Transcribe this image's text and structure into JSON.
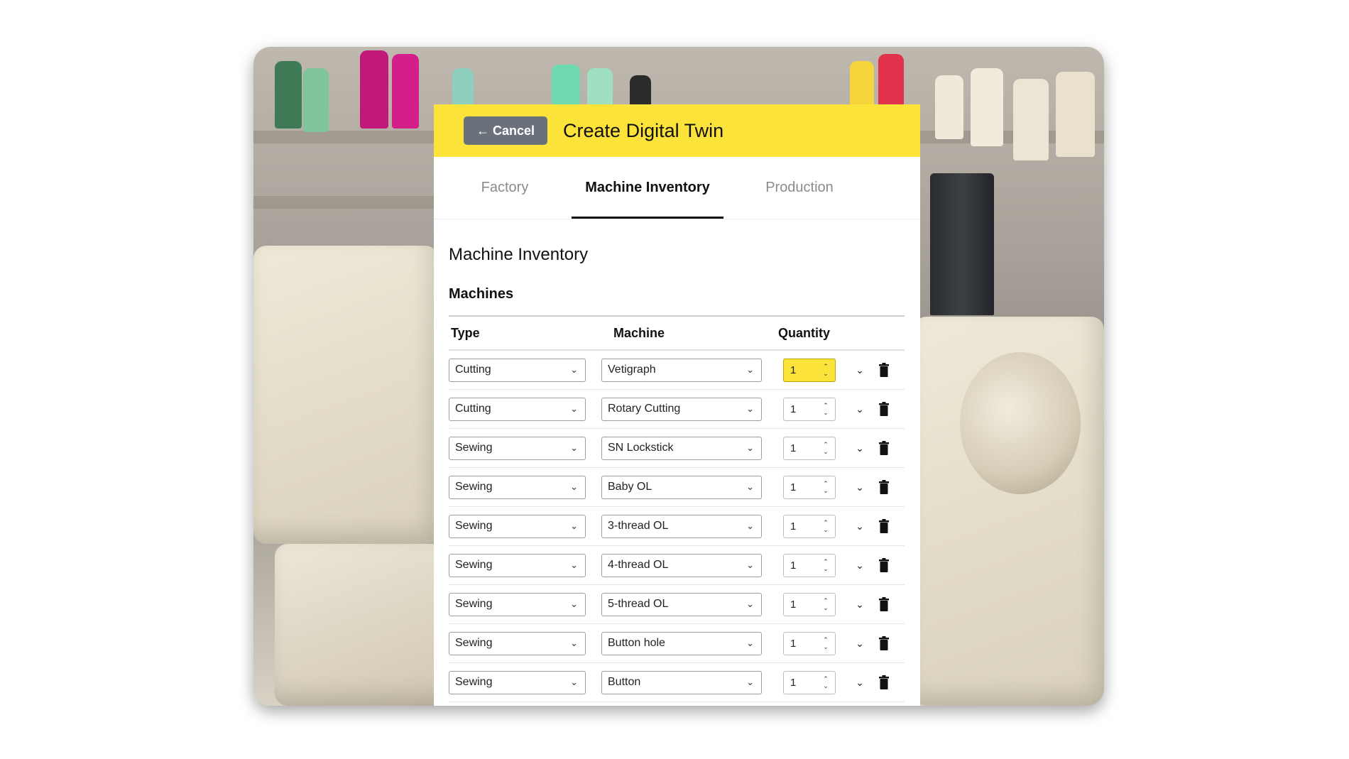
{
  "header": {
    "cancel_label": "← Cancel",
    "title": "Create Digital Twin"
  },
  "tabs": [
    {
      "label": "Factory",
      "active": false
    },
    {
      "label": "Machine Inventory",
      "active": true
    },
    {
      "label": "Production",
      "active": false
    }
  ],
  "section": {
    "title": "Machine Inventory",
    "subtitle": "Machines"
  },
  "table": {
    "headers": {
      "type": "Type",
      "machine": "Machine",
      "quantity": "Quantity"
    },
    "rows": [
      {
        "type": "Cutting",
        "machine": "Vetigraph",
        "quantity": "1"
      },
      {
        "type": "Cutting",
        "machine": "Rotary Cutting",
        "quantity": "1"
      },
      {
        "type": "Sewing",
        "machine": "SN Lockstick",
        "quantity": "1"
      },
      {
        "type": "Sewing",
        "machine": "Baby OL",
        "quantity": "1"
      },
      {
        "type": "Sewing",
        "machine": "3-thread OL",
        "quantity": "1"
      },
      {
        "type": "Sewing",
        "machine": "4-thread OL",
        "quantity": "1"
      },
      {
        "type": "Sewing",
        "machine": "5-thread OL",
        "quantity": "1"
      },
      {
        "type": "Sewing",
        "machine": "Button hole",
        "quantity": "1"
      },
      {
        "type": "Sewing",
        "machine": "Button",
        "quantity": "1"
      }
    ]
  },
  "icons": {
    "dropdown": "chevron-down-icon",
    "stepper": "up-down-stepper-icon",
    "expand": "chevron-down-icon",
    "delete": "trash-icon"
  },
  "colors": {
    "accent": "#fce33a",
    "cancel_button": "#6b717b"
  }
}
